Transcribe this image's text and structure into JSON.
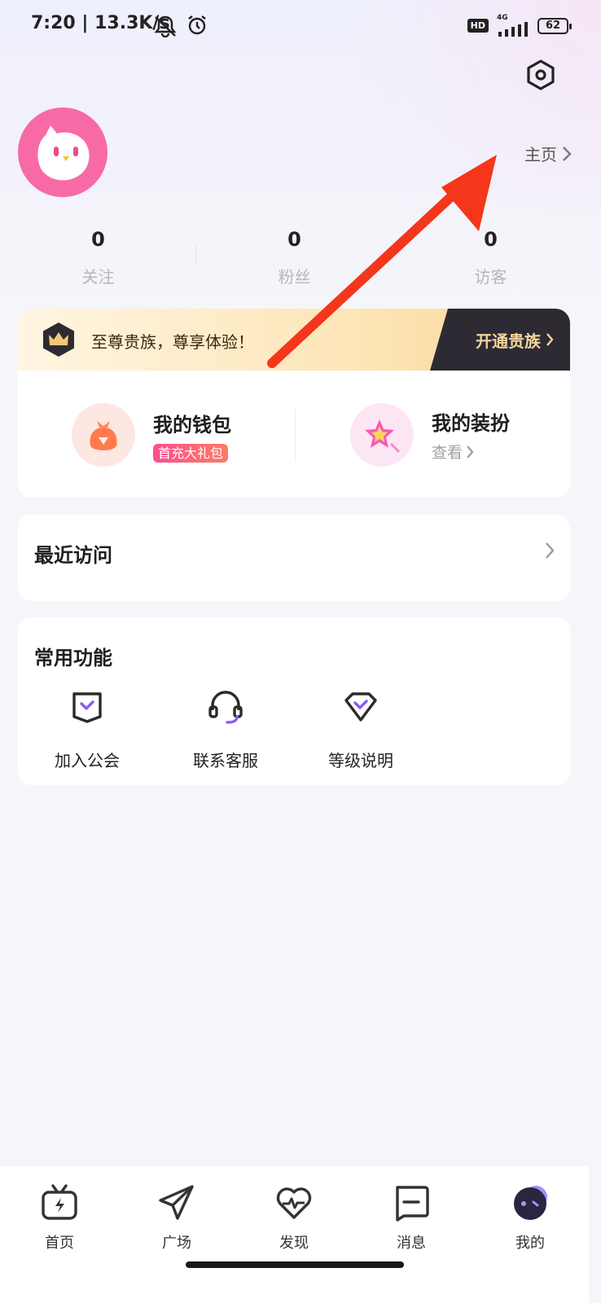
{
  "status_bar": {
    "time": "7:20",
    "speed": "13.3K/s",
    "hd": "HD",
    "network": "4G",
    "battery": "62",
    "icons": [
      "bell-muted-icon",
      "alarm-icon",
      "signal-icon",
      "battery-icon"
    ]
  },
  "profile": {
    "homepage_label": "主页",
    "avatar_icon": "bird-icon"
  },
  "stats": [
    {
      "value": "0",
      "label": "关注"
    },
    {
      "value": "0",
      "label": "粉丝"
    },
    {
      "value": "0",
      "label": "访客"
    }
  ],
  "vip": {
    "text": "至尊贵族，尊享体验！",
    "button": "开通贵族"
  },
  "wallet": {
    "wallet_title": "我的钱包",
    "wallet_tag": "首充大礼包",
    "dress_title": "我的装扮",
    "dress_link": "查看"
  },
  "recent": {
    "title": "最近访问"
  },
  "common": {
    "title": "常用功能",
    "items": [
      {
        "label": "加入公会",
        "icon": "shield-check-icon"
      },
      {
        "label": "联系客服",
        "icon": "headset-icon"
      },
      {
        "label": "等级说明",
        "icon": "diamond-check-icon"
      }
    ]
  },
  "tabs": [
    {
      "label": "首页",
      "icon": "tv-bolt-icon"
    },
    {
      "label": "广场",
      "icon": "paper-plane-icon"
    },
    {
      "label": "发现",
      "icon": "heart-pulse-icon"
    },
    {
      "label": "消息",
      "icon": "chat-box-icon"
    },
    {
      "label": "我的",
      "icon": "avatar-face-icon"
    }
  ],
  "colors": {
    "accent_purple": "#8b5cf6",
    "avatar_pink": "#f86aa6",
    "vip_gold": "#f3d49a",
    "arrow_red": "#f4361b"
  }
}
